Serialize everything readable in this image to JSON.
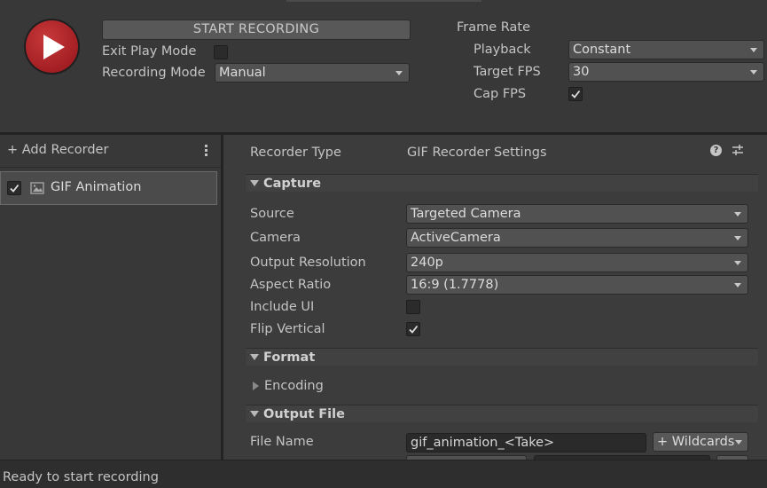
{
  "header": {
    "start_button": "START RECORDING",
    "exit_play_mode_label": "Exit Play Mode",
    "exit_play_mode_checked": false,
    "recording_mode_label": "Recording Mode",
    "recording_mode_value": "Manual",
    "frame_rate_label": "Frame Rate",
    "playback_label": "Playback",
    "playback_value": "Constant",
    "target_fps_label": "Target FPS",
    "target_fps_value": "30",
    "cap_fps_label": "Cap FPS",
    "cap_fps_checked": true
  },
  "recorders": {
    "add_recorder": "+ Add Recorder",
    "items": [
      {
        "label": "GIF Animation",
        "checked": true,
        "icon": "image-icon"
      }
    ]
  },
  "settings": {
    "recorder_type_label": "Recorder Type",
    "recorder_type_value": "GIF Recorder Settings",
    "capture": {
      "title": "Capture",
      "source_label": "Source",
      "source_value": "Targeted Camera",
      "camera_label": "Camera",
      "camera_value": "ActiveCamera",
      "output_resolution_label": "Output Resolution",
      "output_resolution_value": "240p",
      "aspect_ratio_label": "Aspect Ratio",
      "aspect_ratio_value": "16:9 (1.7778)",
      "include_ui_label": "Include UI",
      "include_ui_checked": false,
      "flip_vertical_label": "Flip Vertical",
      "flip_vertical_checked": true
    },
    "format": {
      "title": "Format",
      "encoding_label": "Encoding"
    },
    "output_file": {
      "title": "Output File",
      "file_name_label": "File Name",
      "file_name_value": "gif_animation_<Take>",
      "wildcards_button": "+ Wildcards"
    }
  },
  "status": {
    "text": "Ready to start recording"
  },
  "colors": {
    "record_button": "#b3262a",
    "background": "#383838",
    "panel": "#3c3c3c"
  }
}
